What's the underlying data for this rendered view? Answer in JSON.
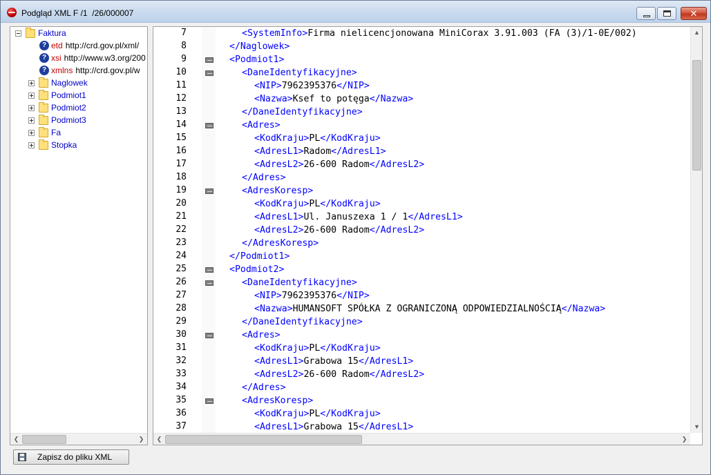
{
  "window": {
    "title": "Podgląd XML F /1  /26/000007"
  },
  "tree": {
    "root": {
      "label": "Faktura"
    },
    "attributes": [
      {
        "name": "etd",
        "value": "http://crd.gov.pl/xml/"
      },
      {
        "name": "xsi",
        "value": "http://www.w3.org/200"
      },
      {
        "name": "xmlns",
        "value": "http://crd.gov.pl/w"
      }
    ],
    "children": [
      {
        "label": "Naglowek"
      },
      {
        "label": "Podmiot1"
      },
      {
        "label": "Podmiot2"
      },
      {
        "label": "Podmiot3"
      },
      {
        "label": "Fa"
      },
      {
        "label": "Stopka"
      }
    ]
  },
  "editor": {
    "lines": [
      {
        "num": "7",
        "fold": false,
        "indent": 2,
        "parts": [
          [
            "t",
            "<SystemInfo>"
          ],
          [
            "x",
            "Firma nielicencjonowana MiniCorax 3.91.003 (FA (3)/1-0E/002)"
          ]
        ]
      },
      {
        "num": "8",
        "fold": false,
        "indent": 1,
        "parts": [
          [
            "t",
            "</Naglowek>"
          ]
        ]
      },
      {
        "num": "9",
        "fold": true,
        "indent": 1,
        "parts": [
          [
            "t",
            "<Podmiot1>"
          ]
        ]
      },
      {
        "num": "10",
        "fold": true,
        "indent": 2,
        "parts": [
          [
            "t",
            "<DaneIdentyfikacyjne>"
          ]
        ]
      },
      {
        "num": "11",
        "fold": false,
        "indent": 3,
        "parts": [
          [
            "t",
            "<NIP>"
          ],
          [
            "x",
            "7962395376"
          ],
          [
            "t",
            "</NIP>"
          ]
        ]
      },
      {
        "num": "12",
        "fold": false,
        "indent": 3,
        "parts": [
          [
            "t",
            "<Nazwa>"
          ],
          [
            "x",
            "Ksef to potęga"
          ],
          [
            "t",
            "</Nazwa>"
          ]
        ]
      },
      {
        "num": "13",
        "fold": false,
        "indent": 2,
        "parts": [
          [
            "t",
            "</DaneIdentyfikacyjne>"
          ]
        ]
      },
      {
        "num": "14",
        "fold": true,
        "indent": 2,
        "parts": [
          [
            "t",
            "<Adres>"
          ]
        ]
      },
      {
        "num": "15",
        "fold": false,
        "indent": 3,
        "parts": [
          [
            "t",
            "<KodKraju>"
          ],
          [
            "x",
            "PL"
          ],
          [
            "t",
            "</KodKraju>"
          ]
        ]
      },
      {
        "num": "16",
        "fold": false,
        "indent": 3,
        "parts": [
          [
            "t",
            "<AdresL1>"
          ],
          [
            "x",
            "Radom"
          ],
          [
            "t",
            "</AdresL1>"
          ]
        ]
      },
      {
        "num": "17",
        "fold": false,
        "indent": 3,
        "parts": [
          [
            "t",
            "<AdresL2>"
          ],
          [
            "x",
            "26-600 Radom"
          ],
          [
            "t",
            "</AdresL2>"
          ]
        ]
      },
      {
        "num": "18",
        "fold": false,
        "indent": 2,
        "parts": [
          [
            "t",
            "</Adres>"
          ]
        ]
      },
      {
        "num": "19",
        "fold": true,
        "indent": 2,
        "parts": [
          [
            "t",
            "<AdresKoresp>"
          ]
        ]
      },
      {
        "num": "20",
        "fold": false,
        "indent": 3,
        "parts": [
          [
            "t",
            "<KodKraju>"
          ],
          [
            "x",
            "PL"
          ],
          [
            "t",
            "</KodKraju>"
          ]
        ]
      },
      {
        "num": "21",
        "fold": false,
        "indent": 3,
        "parts": [
          [
            "t",
            "<AdresL1>"
          ],
          [
            "x",
            "Ul. Januszexa 1 / 1"
          ],
          [
            "t",
            "</AdresL1>"
          ]
        ]
      },
      {
        "num": "22",
        "fold": false,
        "indent": 3,
        "parts": [
          [
            "t",
            "<AdresL2>"
          ],
          [
            "x",
            "26-600 Radom"
          ],
          [
            "t",
            "</AdresL2>"
          ]
        ]
      },
      {
        "num": "23",
        "fold": false,
        "indent": 2,
        "parts": [
          [
            "t",
            "</AdresKoresp>"
          ]
        ]
      },
      {
        "num": "24",
        "fold": false,
        "indent": 1,
        "parts": [
          [
            "t",
            "</Podmiot1>"
          ]
        ]
      },
      {
        "num": "25",
        "fold": true,
        "indent": 1,
        "parts": [
          [
            "t",
            "<Podmiot2>"
          ]
        ]
      },
      {
        "num": "26",
        "fold": true,
        "indent": 2,
        "parts": [
          [
            "t",
            "<DaneIdentyfikacyjne>"
          ]
        ]
      },
      {
        "num": "27",
        "fold": false,
        "indent": 3,
        "parts": [
          [
            "t",
            "<NIP>"
          ],
          [
            "x",
            "7962395376"
          ],
          [
            "t",
            "</NIP>"
          ]
        ]
      },
      {
        "num": "28",
        "fold": false,
        "indent": 3,
        "parts": [
          [
            "t",
            "<Nazwa>"
          ],
          [
            "x",
            "HUMANSOFT SPÓŁKA Z OGRANICZONĄ ODPOWIEDZIALNOŚCIĄ"
          ],
          [
            "t",
            "</Nazwa>"
          ]
        ]
      },
      {
        "num": "29",
        "fold": false,
        "indent": 2,
        "parts": [
          [
            "t",
            "</DaneIdentyfikacyjne>"
          ]
        ]
      },
      {
        "num": "30",
        "fold": true,
        "indent": 2,
        "parts": [
          [
            "t",
            "<Adres>"
          ]
        ]
      },
      {
        "num": "31",
        "fold": false,
        "indent": 3,
        "parts": [
          [
            "t",
            "<KodKraju>"
          ],
          [
            "x",
            "PL"
          ],
          [
            "t",
            "</KodKraju>"
          ]
        ]
      },
      {
        "num": "32",
        "fold": false,
        "indent": 3,
        "parts": [
          [
            "t",
            "<AdresL1>"
          ],
          [
            "x",
            "Grabowa 15"
          ],
          [
            "t",
            "</AdresL1>"
          ]
        ]
      },
      {
        "num": "33",
        "fold": false,
        "indent": 3,
        "parts": [
          [
            "t",
            "<AdresL2>"
          ],
          [
            "x",
            "26-600 Radom"
          ],
          [
            "t",
            "</AdresL2>"
          ]
        ]
      },
      {
        "num": "34",
        "fold": false,
        "indent": 2,
        "parts": [
          [
            "t",
            "</Adres>"
          ]
        ]
      },
      {
        "num": "35",
        "fold": true,
        "indent": 2,
        "parts": [
          [
            "t",
            "<AdresKoresp>"
          ]
        ]
      },
      {
        "num": "36",
        "fold": false,
        "indent": 3,
        "parts": [
          [
            "t",
            "<KodKraju>"
          ],
          [
            "x",
            "PL"
          ],
          [
            "t",
            "</KodKraju>"
          ]
        ]
      },
      {
        "num": "37",
        "fold": false,
        "indent": 3,
        "parts": [
          [
            "t",
            "<AdresL1>"
          ],
          [
            "x",
            "Grabowa 15"
          ],
          [
            "t",
            "</AdresL1>"
          ]
        ]
      }
    ]
  },
  "footer": {
    "save_label": "Zapisz do pliku XML"
  },
  "colors": {
    "tag": "#0000ff",
    "text": "#000000",
    "tree_node": "#0000cc",
    "attr_name": "#c00000"
  },
  "icons": {
    "app": "app-logo-icon",
    "folder": "folder-icon",
    "attribute": "question-icon",
    "save": "floppy-disk-icon"
  }
}
